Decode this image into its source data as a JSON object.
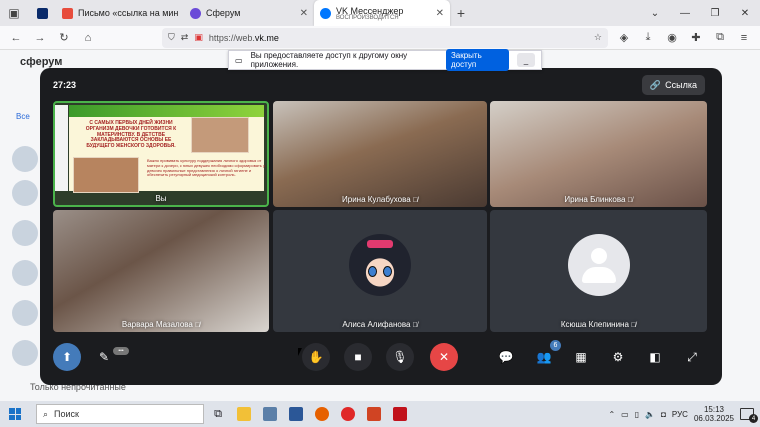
{
  "browser": {
    "tabs": [
      {
        "title": "Письмо «ссылка на минутки б",
        "sub": "",
        "active": false,
        "favicon_color": "#e74c3c"
      },
      {
        "title": "Сферум",
        "sub": "",
        "active": false,
        "favicon_color": "#6b4bd8"
      },
      {
        "title": "VK Мессенджер",
        "sub": "ВОСПРОИЗВОДИТСЯ",
        "active": true,
        "favicon_color": "#0077ff"
      }
    ],
    "url_prefix": "https://web.",
    "url_domain": "vk.me"
  },
  "share_bar": {
    "message": "Вы предоставляете доступ к другому окну приложения.",
    "allow_label": "Закрыть доступ",
    "hide_label": "_"
  },
  "page": {
    "logo": "сферум",
    "filter_label": "Все",
    "unread_label": "Только непрочитанные"
  },
  "call": {
    "timer": "27:23",
    "link_label": "Ссылка",
    "participants": [
      {
        "name": "Вы",
        "muted": false
      },
      {
        "name": "Ирина Кулабухова",
        "muted": true
      },
      {
        "name": "Ирина Блинкова",
        "muted": true
      },
      {
        "name": "Варвара Мазалова",
        "muted": true
      },
      {
        "name": "Алиса Алифанова",
        "muted": true
      },
      {
        "name": "Ксюша Клепинина",
        "muted": true
      }
    ],
    "slide_text": "С САМЫХ ПЕРВЫХ ДНЕЙ ЖИЗНИ ОРГАНИЗМ ДЕВОЧКИ ГОТОВИТСЯ К МАТЕРИНСТВУ. В ДЕТСТВЕ ЗАКЛАДЫВАЮТСЯ ОСНОВЫ ЕЕ БУДУЩЕГО ЖЕНСКОГО ЗДОРОВЬЯ.",
    "slide_text2": "Важно прививать культуру поддержания личного здоровья от матери к дочери, с юных девушек необходимо сформировать у девочек правильные представления о личной гигиене и обеспечить регулярный медицинский контроль.",
    "pill_label": "•••",
    "participants_badge": "6"
  },
  "taskbar": {
    "search_placeholder": "Поиск",
    "lang": "РУС",
    "time": "15:13",
    "date": "06.03.2025",
    "notifications": "4"
  }
}
